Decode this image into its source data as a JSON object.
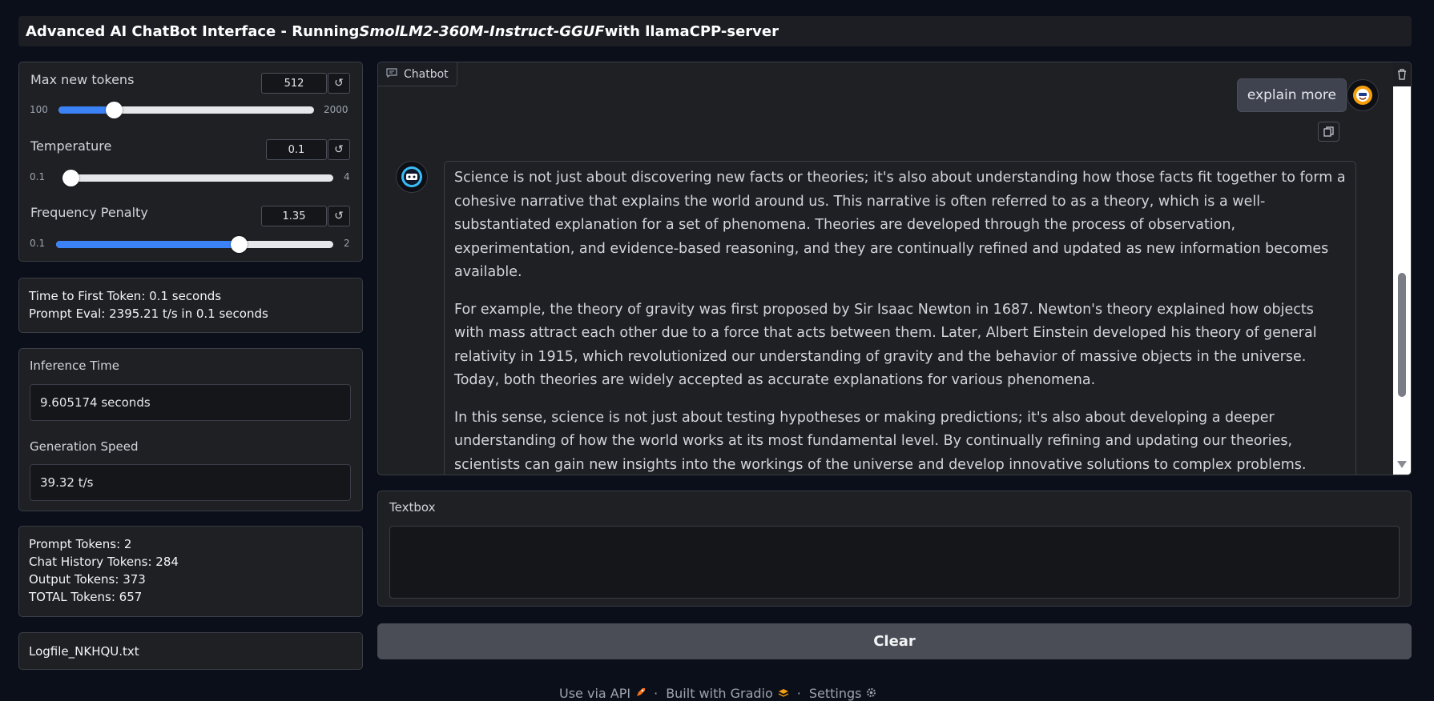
{
  "header": {
    "title_prefix": "Advanced AI ChatBot Interface - Running ",
    "model_name": "SmolLM2-360M-Instruct-GGUF",
    "title_suffix": " with llamaCPP-server"
  },
  "settings": {
    "max_tokens": {
      "label": "Max new tokens",
      "value": "512",
      "min": "100",
      "max": "2000",
      "fraction": 0.2168
    },
    "temperature": {
      "label": "Temperature",
      "value": "0.1",
      "min": "0.1",
      "max": "4",
      "fraction": 0.0
    },
    "frequency_penalty": {
      "label": "Frequency Penalty",
      "value": "1.35",
      "min": "0.1",
      "max": "2",
      "fraction": 0.6579
    },
    "reset_glyph": "↺"
  },
  "timing": {
    "first_token": "Time to First Token: 0.1 seconds",
    "prompt_eval": "Prompt Eval: 2395.21  t/s in 0.1 seconds"
  },
  "inference": {
    "inference_label": "Inference Time",
    "inference_value": "9.605174 seconds",
    "speed_label": "Generation Speed",
    "speed_value": "39.32  t/s"
  },
  "tokens": {
    "prompt": "Prompt Tokens: 2",
    "history": "Chat History Tokens: 284",
    "output": "Output Tokens: 373",
    "total": "TOTAL Tokens: 657"
  },
  "logfile": "Logfile_NKHQU.txt",
  "chatbot": {
    "label": "Chatbot",
    "user_message": "explain more",
    "bot_paragraphs": [
      "Science is not just about discovering new facts or theories; it's also about understanding how those facts fit together to form a cohesive narrative that explains the world around us. This narrative is often referred to as a theory, which is a well-substantiated explanation for a set of phenomena. Theories are developed through the process of observation, experimentation, and evidence-based reasoning, and they are continually refined and updated as new information becomes available.",
      "For example, the theory of gravity was first proposed by Sir Isaac Newton in 1687. Newton's theory explained how objects with mass attract each other due to a force that acts between them. Later, Albert Einstein developed his theory of general relativity in 1915, which revolutionized our understanding of gravity and the behavior of massive objects in the universe. Today, both theories are widely accepted as accurate explanations for various phenomena.",
      "In this sense, science is not just about testing hypotheses or making predictions; it's also about developing a deeper understanding of how the world works at its most fundamental level. By continually refining and updating our theories, scientists can gain new insights into the workings of the universe and develop innovative solutions to complex problems."
    ]
  },
  "textbox": {
    "label": "Textbox",
    "value": ""
  },
  "clear_button": "Clear",
  "footer": {
    "api": "Use via API",
    "built": "Built with Gradio",
    "settings": "Settings",
    "separator": "·"
  },
  "colors": {
    "background": "#0b0f19",
    "panel": "#1f2024",
    "slider_fill": "#3b82f6",
    "button": "#4a4d56"
  }
}
